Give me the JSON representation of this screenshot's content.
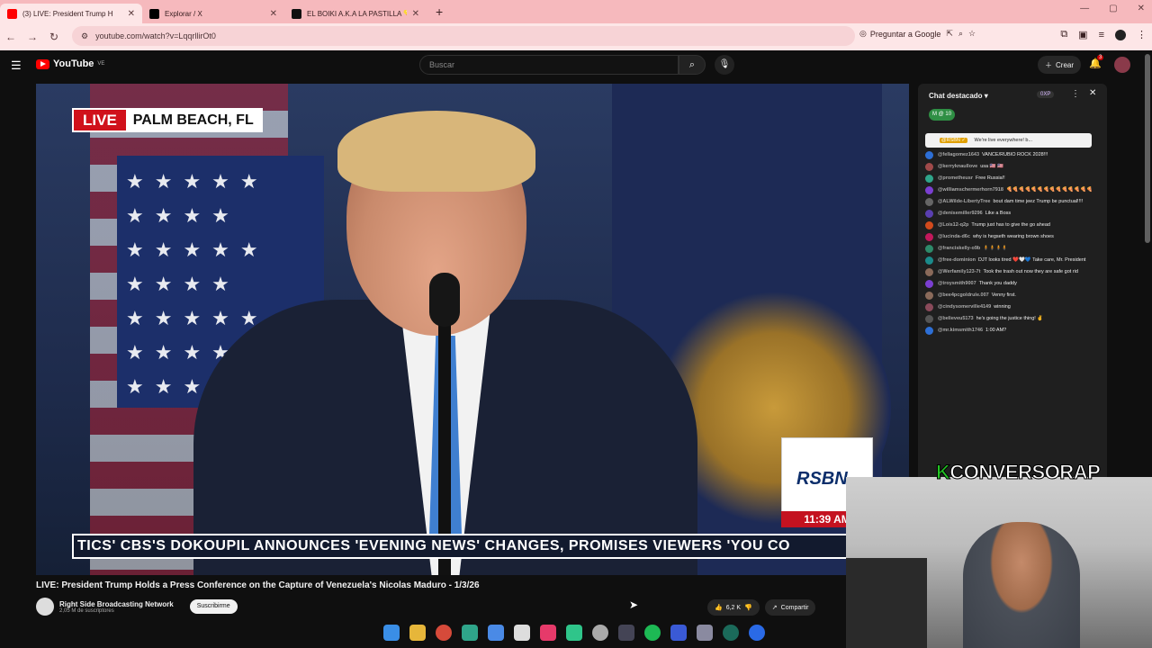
{
  "browser": {
    "tabs": [
      {
        "title": "(3) LIVE: President Trump H",
        "favicon_color": "#ff0000",
        "active": true
      },
      {
        "title": "Explorar / X",
        "favicon_color": "#000000",
        "active": false
      },
      {
        "title": "EL BOIKI A.K.A LA PASTILLA 💊",
        "favicon_color": "#111111",
        "active": false
      }
    ],
    "new_tab": "+",
    "url": "youtube.com/watch?v=LqqrllirOt0",
    "ask_google": "Preguntar a Google"
  },
  "youtube": {
    "logo_text": "YouTube",
    "logo_region": "VE",
    "search_placeholder": "Buscar",
    "create_label": "Crear",
    "notifications": "3"
  },
  "video": {
    "live_label": "LIVE",
    "location": "PALM BEACH, FL",
    "ticker": "TICS'    CBS'S DOKOUPIL ANNOUNCES 'EVENING NEWS' CHANGES, PROMISES VIEWERS 'YOU CO",
    "brand": "RSBN",
    "time": "11:39 AM",
    "title": "LIVE: President Trump Holds a Press Conference on the Capture of Venezuela's Nicolas Maduro - 1/3/26",
    "channel_name": "Right Side Broadcasting Network",
    "subscribers": "2,05 M de suscriptores",
    "subscribe_label": "Suscribirme",
    "likes": "6,2 K",
    "share_label": "Compartir"
  },
  "chat": {
    "header": "Chat destacado",
    "points": "0XP",
    "poll_badge": "M @ 10",
    "pinned_user": "@RSBN ✓",
    "pinned_text": "We're live everywhere! b...",
    "messages": [
      {
        "user": "@fellagomez1643",
        "text": "VANCE/RUBIO ROCK 2028!!!",
        "color": "#2d6fd6"
      },
      {
        "user": "@kerryknaullove",
        "text": "usa 🇺🇸 🇺🇸",
        "color": "#a04a4a"
      },
      {
        "user": "@prometheusr",
        "text": "Free Russia!!",
        "color": "#2fa58a"
      },
      {
        "user": "@williamschermerhorn7918",
        "text": "🍕🍕🍕🍕🍕🍕🍕🍕🍕🍕🍕🍕🍕🍕",
        "color": "#7b3fd1"
      },
      {
        "user": "@ALWilde-LibertyTree",
        "text": "bout dam time jeez Trump be punctual!!!!",
        "color": "#666666"
      },
      {
        "user": "@denisemiller9296",
        "text": "Like a Boss",
        "color": "#5a3fb0"
      },
      {
        "user": "@Lois12-q2p",
        "text": "Trump just has to give the go ahead",
        "color": "#d24a1c"
      },
      {
        "user": "@lucinda-d6c",
        "text": "why is hegseth wearing brown shoes",
        "color": "#c2185b"
      },
      {
        "user": "@franciskelly-o9b",
        "text": "🧍🧍🧍🧍",
        "color": "#2d8a6a"
      },
      {
        "user": "@free-dominion",
        "text": "DJT looks tired ❤️🤍💙 Take care, Mr. President",
        "color": "#1b8a8a"
      },
      {
        "user": "@Werfamily123-7t",
        "text": "Took the trash out now they are safe got rid",
        "color": "#8a6a5a"
      },
      {
        "user": "@troysmith9007",
        "text": "Thank you daddy",
        "color": "#7b3fd1"
      },
      {
        "user": "@bee4pcgoldrule.007",
        "text": "Venny first.",
        "color": "#8a6a5a"
      },
      {
        "user": "@cindysomerville4149",
        "text": "winning",
        "color": "#8a4a5a"
      },
      {
        "user": "@believeu5173",
        "text": "he's going the justice thing! ✌",
        "color": "#555555"
      },
      {
        "user": "@mr.kimsmith1746",
        "text": "1:00 AM?",
        "color": "#2d6fd6"
      }
    ]
  },
  "webcam": {
    "logo_k": "K",
    "logo_text": "CONVERSORAP"
  },
  "colors": {
    "tabbar": "#f6b9bd",
    "yt_red": "#ff0000",
    "live_red": "#d0111b"
  }
}
